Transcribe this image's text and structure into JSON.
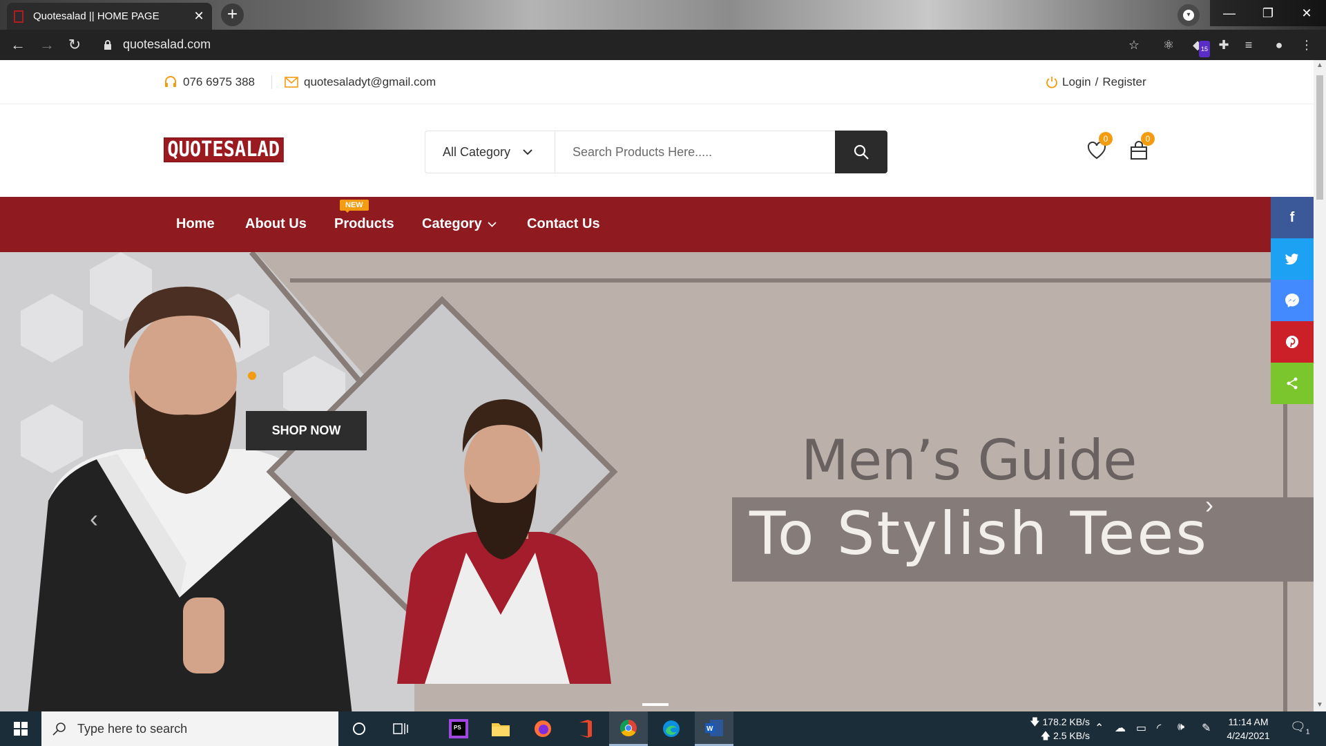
{
  "browser": {
    "tab_title": "Quotesalad || HOME PAGE",
    "url": "quotesalad.com",
    "extension_badge": "15"
  },
  "topbar": {
    "phone": "076 6975 388",
    "email": "quotesaladyt@gmail.com",
    "login": "Login",
    "separator": "/",
    "register": "Register"
  },
  "header": {
    "logo": "QUOTESALAD",
    "category_select": "All Category",
    "search_placeholder": "Search Products Here.....",
    "wishlist_count": "0",
    "cart_count": "0"
  },
  "nav": {
    "items": [
      "Home",
      "About Us",
      "Products",
      "Category",
      "Contact Us"
    ],
    "new_badge": "NEW"
  },
  "hero": {
    "cta": "SHOP NOW",
    "title_line1": "Men’s Guide",
    "title_line2": "To Stylish Tees"
  },
  "share": [
    "f",
    "twitter",
    "messenger",
    "pinterest",
    "share"
  ],
  "taskbar": {
    "search_placeholder": "Type here to search",
    "net_down": "178.2 KB/s",
    "net_up": "2.5 KB/s",
    "time": "11:14 AM",
    "date": "4/24/2021",
    "notification_count": "1"
  },
  "colors": {
    "brand_red": "#8f1a1f",
    "accent_orange": "#f39c12",
    "facebook": "#3b5998",
    "twitter": "#1da1f2",
    "messenger": "#448aff",
    "pinterest": "#cb2027",
    "sharethis": "#7bc62d"
  }
}
